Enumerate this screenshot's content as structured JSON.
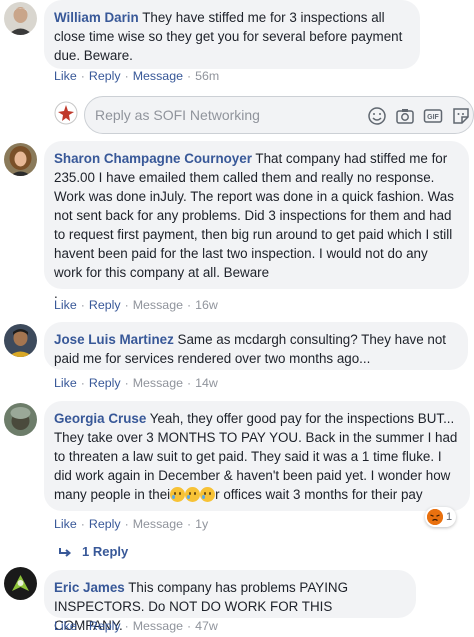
{
  "account_name": "SOFI Networking",
  "reply_box": {
    "placeholder": "Reply as SOFI Networking"
  },
  "actions": {
    "like": "Like",
    "reply": "Reply",
    "message": "Message",
    "sep": "·"
  },
  "comments": [
    {
      "author": "William Darin",
      "text": "They have stiffed me for 3 inspections all close time wise so they get you for several before payment due. Beware.",
      "time": "56m"
    },
    {
      "author": "Sharon Champagne Cournoyer",
      "text": "That company had stiffed me for 235.00 I have emailed them called them and really no response. Work was done inJuly. The report was done in a quick fashion. Was not sent back for any problems. Did 3 inspections for them and had to request first payment, then big run around to get paid which I still havent been paid for the last two inspection. I would not do any work for this company at all. Beware",
      "extra": ".",
      "time": "16w"
    },
    {
      "author": "Jose Luis Martinez",
      "text": "Same as mcdargh consulting? They have not paid me for services rendered over two months ago...",
      "time": "14w"
    },
    {
      "author": "Georgia Cruse",
      "text": "Yeah, they offer good pay for the inspections BUT... They take over 3 MONTHS TO PAY YOU. Back in the summer I had to threaten a law suit to get paid. They said it was a 1 time fluke. I did work again in December & haven't been paid yet. I wonder how many people in thei",
      "text_end": "r offices wait 3 months for their pay",
      "time": "1y",
      "reaction_count": "1",
      "replies_label": "1 Reply"
    },
    {
      "author": "Eric James",
      "text": "This company has problems PAYING INSPECTORS. Do NOT DO WORK FOR THIS COMPANY.",
      "time": "47w"
    }
  ],
  "icons": [
    "emoji-icon",
    "camera-icon",
    "gif-icon",
    "sticker-icon",
    "angry-reaction-icon",
    "reply-arrow-icon"
  ],
  "colors": {
    "link": "#385898",
    "muted": "#90949c",
    "bubble": "#f2f3f5",
    "angry": "#e9710f"
  }
}
